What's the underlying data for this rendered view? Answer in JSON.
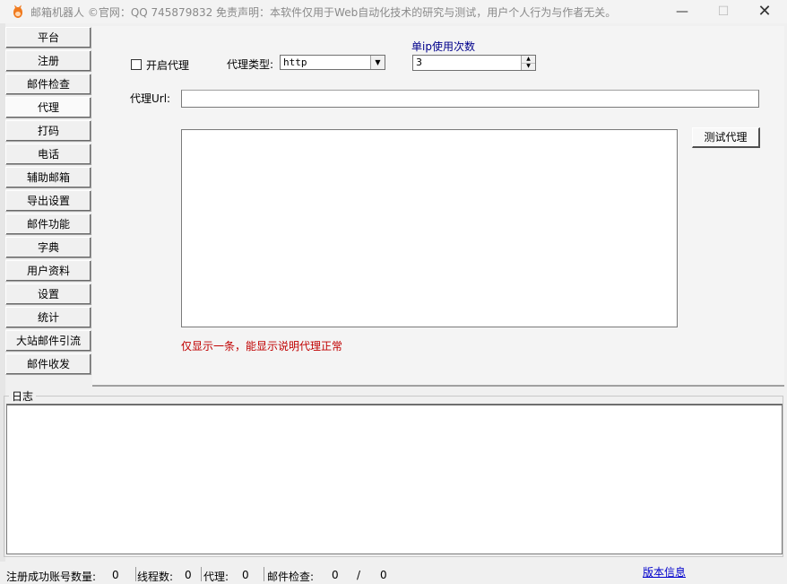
{
  "window": {
    "title": "邮箱机器人 ©官网：QQ   745879832      免责声明：本软件仅用于Web自动化技术的研究与测试，用户个人行为与作者无关。",
    "min_glyph": "—",
    "max_glyph": "☐",
    "close_glyph": "✕"
  },
  "nav": {
    "items": [
      "平台",
      "注册",
      "邮件检查",
      "代理",
      "打码",
      "电话",
      "辅助邮箱",
      "导出设置",
      "邮件功能",
      "字典",
      "用户资料",
      "设置",
      "统计",
      "大站邮件引流",
      "邮件收发"
    ],
    "active_index": 3
  },
  "proxy": {
    "enable_label": "开启代理",
    "enabled": false,
    "type_label": "代理类型:",
    "type_value": "http",
    "ip_use_label": "单ip使用次数",
    "ip_use_value": "3",
    "url_label": "代理Url:",
    "url_value": "",
    "test_button": "测试代理",
    "hint": "仅显示一条，能显示说明代理正常"
  },
  "log": {
    "title": "日志"
  },
  "status": {
    "registered_label": "注册成功账号数量:",
    "registered_value": "0",
    "threads_label": "线程数:",
    "threads_value": "0",
    "proxy_label": "代理:",
    "proxy_value": "0",
    "mail_check_label": "邮件检查:",
    "mail_check_value": "0",
    "mail_check_sep": "/",
    "mail_check_total": "0",
    "version_link": "版本信息"
  },
  "colors": {
    "hint_red": "#c00000",
    "label_blue": "#00008b",
    "link_blue": "#0000cc",
    "icon_orange": "#f07a1e"
  }
}
